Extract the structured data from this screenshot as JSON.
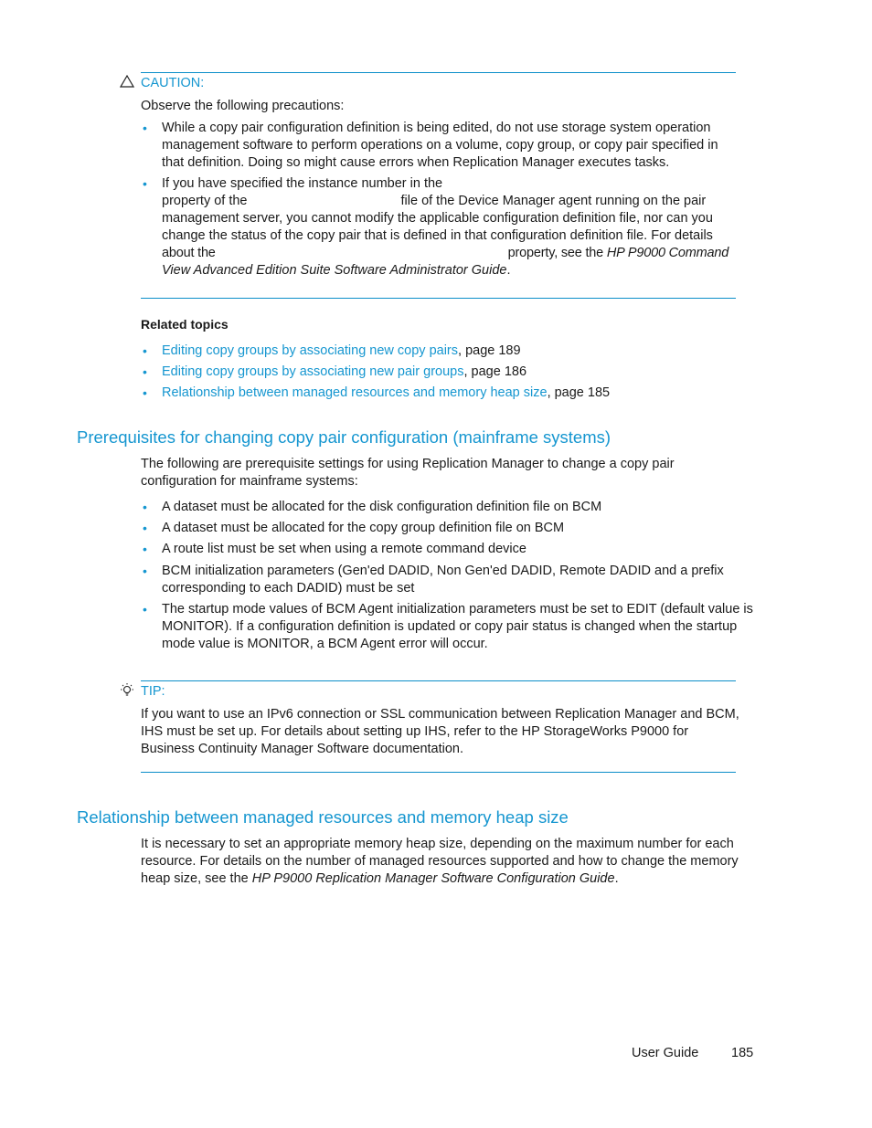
{
  "caution": {
    "icon": "warning-triangle-icon",
    "label": "CAUTION:",
    "intro": "Observe the following precautions:",
    "items": [
      {
        "text": "While a copy pair configuration definition is being edited, do not use storage system operation management software to perform operations on a volume, copy group, or copy pair specified in that definition. Doing so might cause errors when Replication Manager executes tasks."
      },
      {
        "line1": "If you have specified the instance number in the",
        "line2a": "property of the",
        "line2b": "file of the Device Manager agent running on the pair",
        "line3": "management server, you cannot modify the applicable configuration definition file, nor can you",
        "line4": "change the status of the copy pair that is defined in that configuration definition file. For details",
        "line5a": "about the",
        "line5b": "property, see the ",
        "guide_part1": "HP P9000 Command",
        "guide_part2": "View Advanced Edition Suite Software Administrator Guide",
        "end": "."
      }
    ]
  },
  "related": {
    "heading": "Related topics",
    "items": [
      {
        "link": "Editing copy groups by associating new copy pairs",
        "suffix": ", page 189"
      },
      {
        "link": "Editing copy groups by associating new pair groups",
        "suffix": ", page 186"
      },
      {
        "link": "Relationship between managed resources and memory heap size",
        "suffix": ", page 185"
      }
    ]
  },
  "section1": {
    "title": "Prerequisites for changing copy pair configuration (mainframe systems)",
    "intro": "The following are prerequisite settings for using Replication Manager to change a copy pair configuration for mainframe systems:",
    "items": [
      "A dataset must be allocated for the disk configuration definition file on BCM",
      "A dataset must be allocated for the copy group definition file on BCM",
      "A route list must be set when using a remote command device",
      "BCM initialization parameters (Gen'ed DADID, Non Gen'ed DADID, Remote DADID and a prefix corresponding to each DADID) must be set",
      "The startup mode values of BCM Agent initialization parameters must be set to EDIT (default value is MONITOR). If a configuration definition is updated or copy pair status is changed when the startup mode value is MONITOR, a BCM Agent error will occur."
    ]
  },
  "tip": {
    "icon": "lightbulb-icon",
    "label": "TIP:",
    "text": "If you want to use an IPv6 connection or SSL communication between Replication Manager and BCM, IHS must be set up. For details about setting up IHS, refer to the HP StorageWorks P9000 for Business Continuity Manager Software documentation."
  },
  "section2": {
    "title": "Relationship between managed resources and memory heap size",
    "text": "It is necessary to set an appropriate memory heap size, depending on the maximum number for each resource. For details on the number of managed resources supported and how to change the memory heap size, see the ",
    "guide": "HP P9000 Replication Manager Software Configuration Guide",
    "end": "."
  },
  "footer": {
    "label": "User Guide",
    "page": "185"
  },
  "colors": {
    "accent": "#1596d0",
    "text": "#1a1a1a"
  }
}
